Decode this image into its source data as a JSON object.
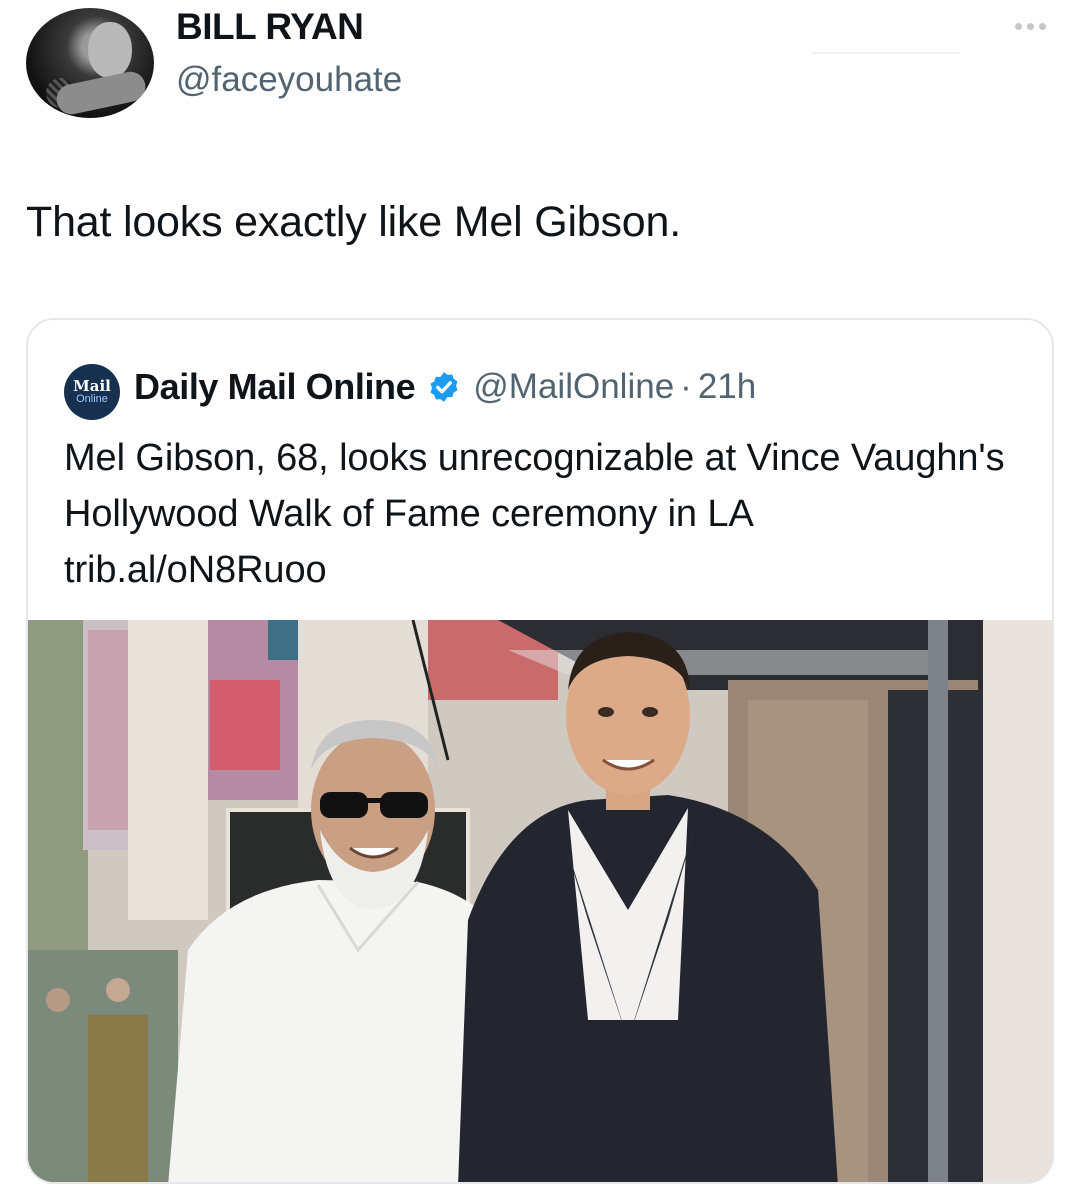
{
  "author": {
    "name": "BILL RYAN",
    "handle": "@faceyouhate"
  },
  "tweet": {
    "text": "That looks exactly like Mel Gibson."
  },
  "quoted": {
    "logo_line1": "Mail",
    "logo_line2": "Online",
    "name": "Daily Mail Online",
    "handle": "@MailOnline",
    "separator": "·",
    "time": "21h",
    "text": "Mel Gibson, 68, looks unrecognizable at Vince Vaughn's Hollywood Walk of Fame ceremony in LA trib.al/oN8Ruoo",
    "verified_color": "#1d9bf0",
    "logo_bg": "#16304f"
  },
  "icons": {
    "more": "ellipsis-horizontal-icon",
    "verified": "verified-badge-icon"
  }
}
